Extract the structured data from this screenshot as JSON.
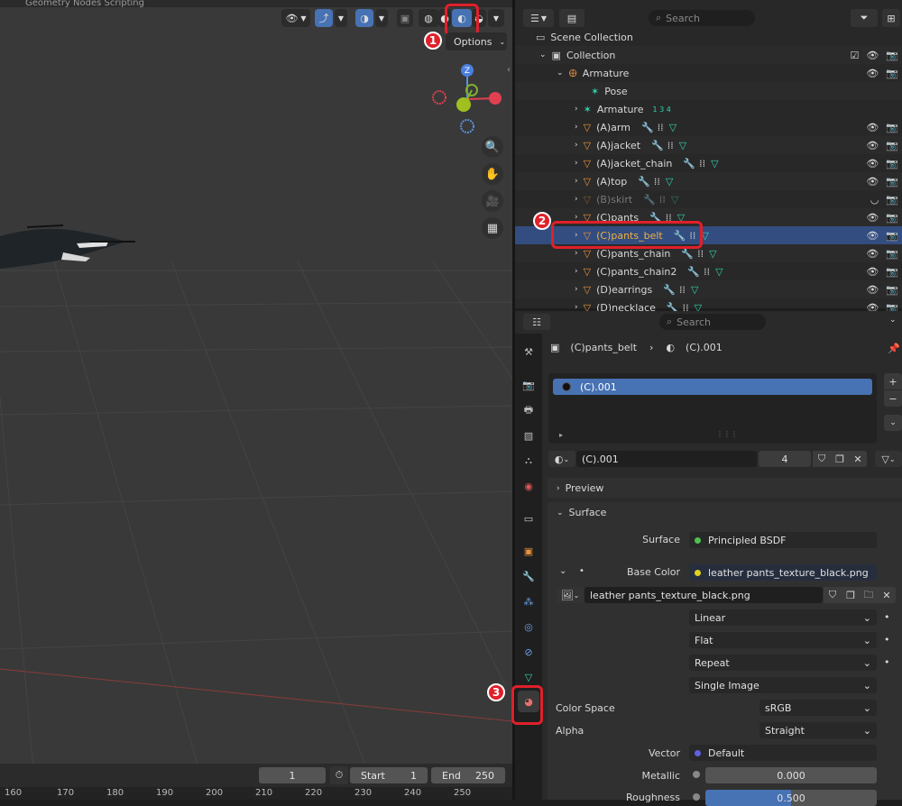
{
  "viewport": {
    "top_strip_text": "Geometry Nodes    Scripting",
    "options_label": "Options",
    "gizmo_axis_z": "Z",
    "badges": [
      "1",
      "2",
      "3"
    ]
  },
  "timeline": {
    "current_frame": "1",
    "start_label": "Start",
    "start_value": "1",
    "end_label": "End",
    "end_value": "250",
    "ruler_ticks": [
      "160",
      "170",
      "180",
      "190",
      "200",
      "210",
      "220",
      "230",
      "240",
      "250"
    ]
  },
  "outliner": {
    "search_placeholder": "Search",
    "scene_collection": "Scene Collection",
    "collection": "Collection",
    "armature_parent": "Armature",
    "pose": "Pose",
    "armature_data": "Armature",
    "armature_badge": "1 3 4",
    "objects": [
      {
        "name": "(A)arm",
        "dim": false
      },
      {
        "name": "(A)jacket",
        "dim": false
      },
      {
        "name": "(A)jacket_chain",
        "dim": false
      },
      {
        "name": "(A)top",
        "dim": false
      },
      {
        "name": "(B)skirt",
        "dim": true
      },
      {
        "name": "(C)pants",
        "dim": false
      },
      {
        "name": "(C)pants_belt",
        "dim": false,
        "selected": true
      },
      {
        "name": "(C)pants_chain",
        "dim": false
      },
      {
        "name": "(C)pants_chain2",
        "dim": false
      },
      {
        "name": "(D)earrings",
        "dim": false
      },
      {
        "name": "(D)necklace",
        "dim": false
      }
    ]
  },
  "properties": {
    "search_placeholder": "Search",
    "breadcrumb_object": "(C)pants_belt",
    "breadcrumb_material": "(C).001",
    "slot_name": "(C).001",
    "material_name": "(C).001",
    "users_count": "4",
    "preview_label": "Preview",
    "surface_section": "Surface",
    "surface_label": "Surface",
    "surface_value": "Principled BSDF",
    "base_color_label": "Base Color",
    "base_color_value": "leather pants_texture_black.png",
    "image_name": "leather pants_texture_black.png",
    "interpolation": "Linear",
    "projection": "Flat",
    "extension": "Repeat",
    "source": "Single Image",
    "color_space_label": "Color Space",
    "color_space_value": "sRGB",
    "alpha_label": "Alpha",
    "alpha_value": "Straight",
    "vector_label": "Vector",
    "vector_value": "Default",
    "metallic_label": "Metallic",
    "metallic_value": "0.000",
    "roughness_label": "Roughness",
    "roughness_value": "0.500",
    "roughness_fill": 0.5
  },
  "colors": {
    "accent_blue": "#4772b3",
    "selected_row": "#334d80",
    "highlight_red": "#e0202a",
    "object_orange": "#e8913a",
    "modifier_blue": "#6ea0e8",
    "mesh_green": "#2fd3b0"
  }
}
